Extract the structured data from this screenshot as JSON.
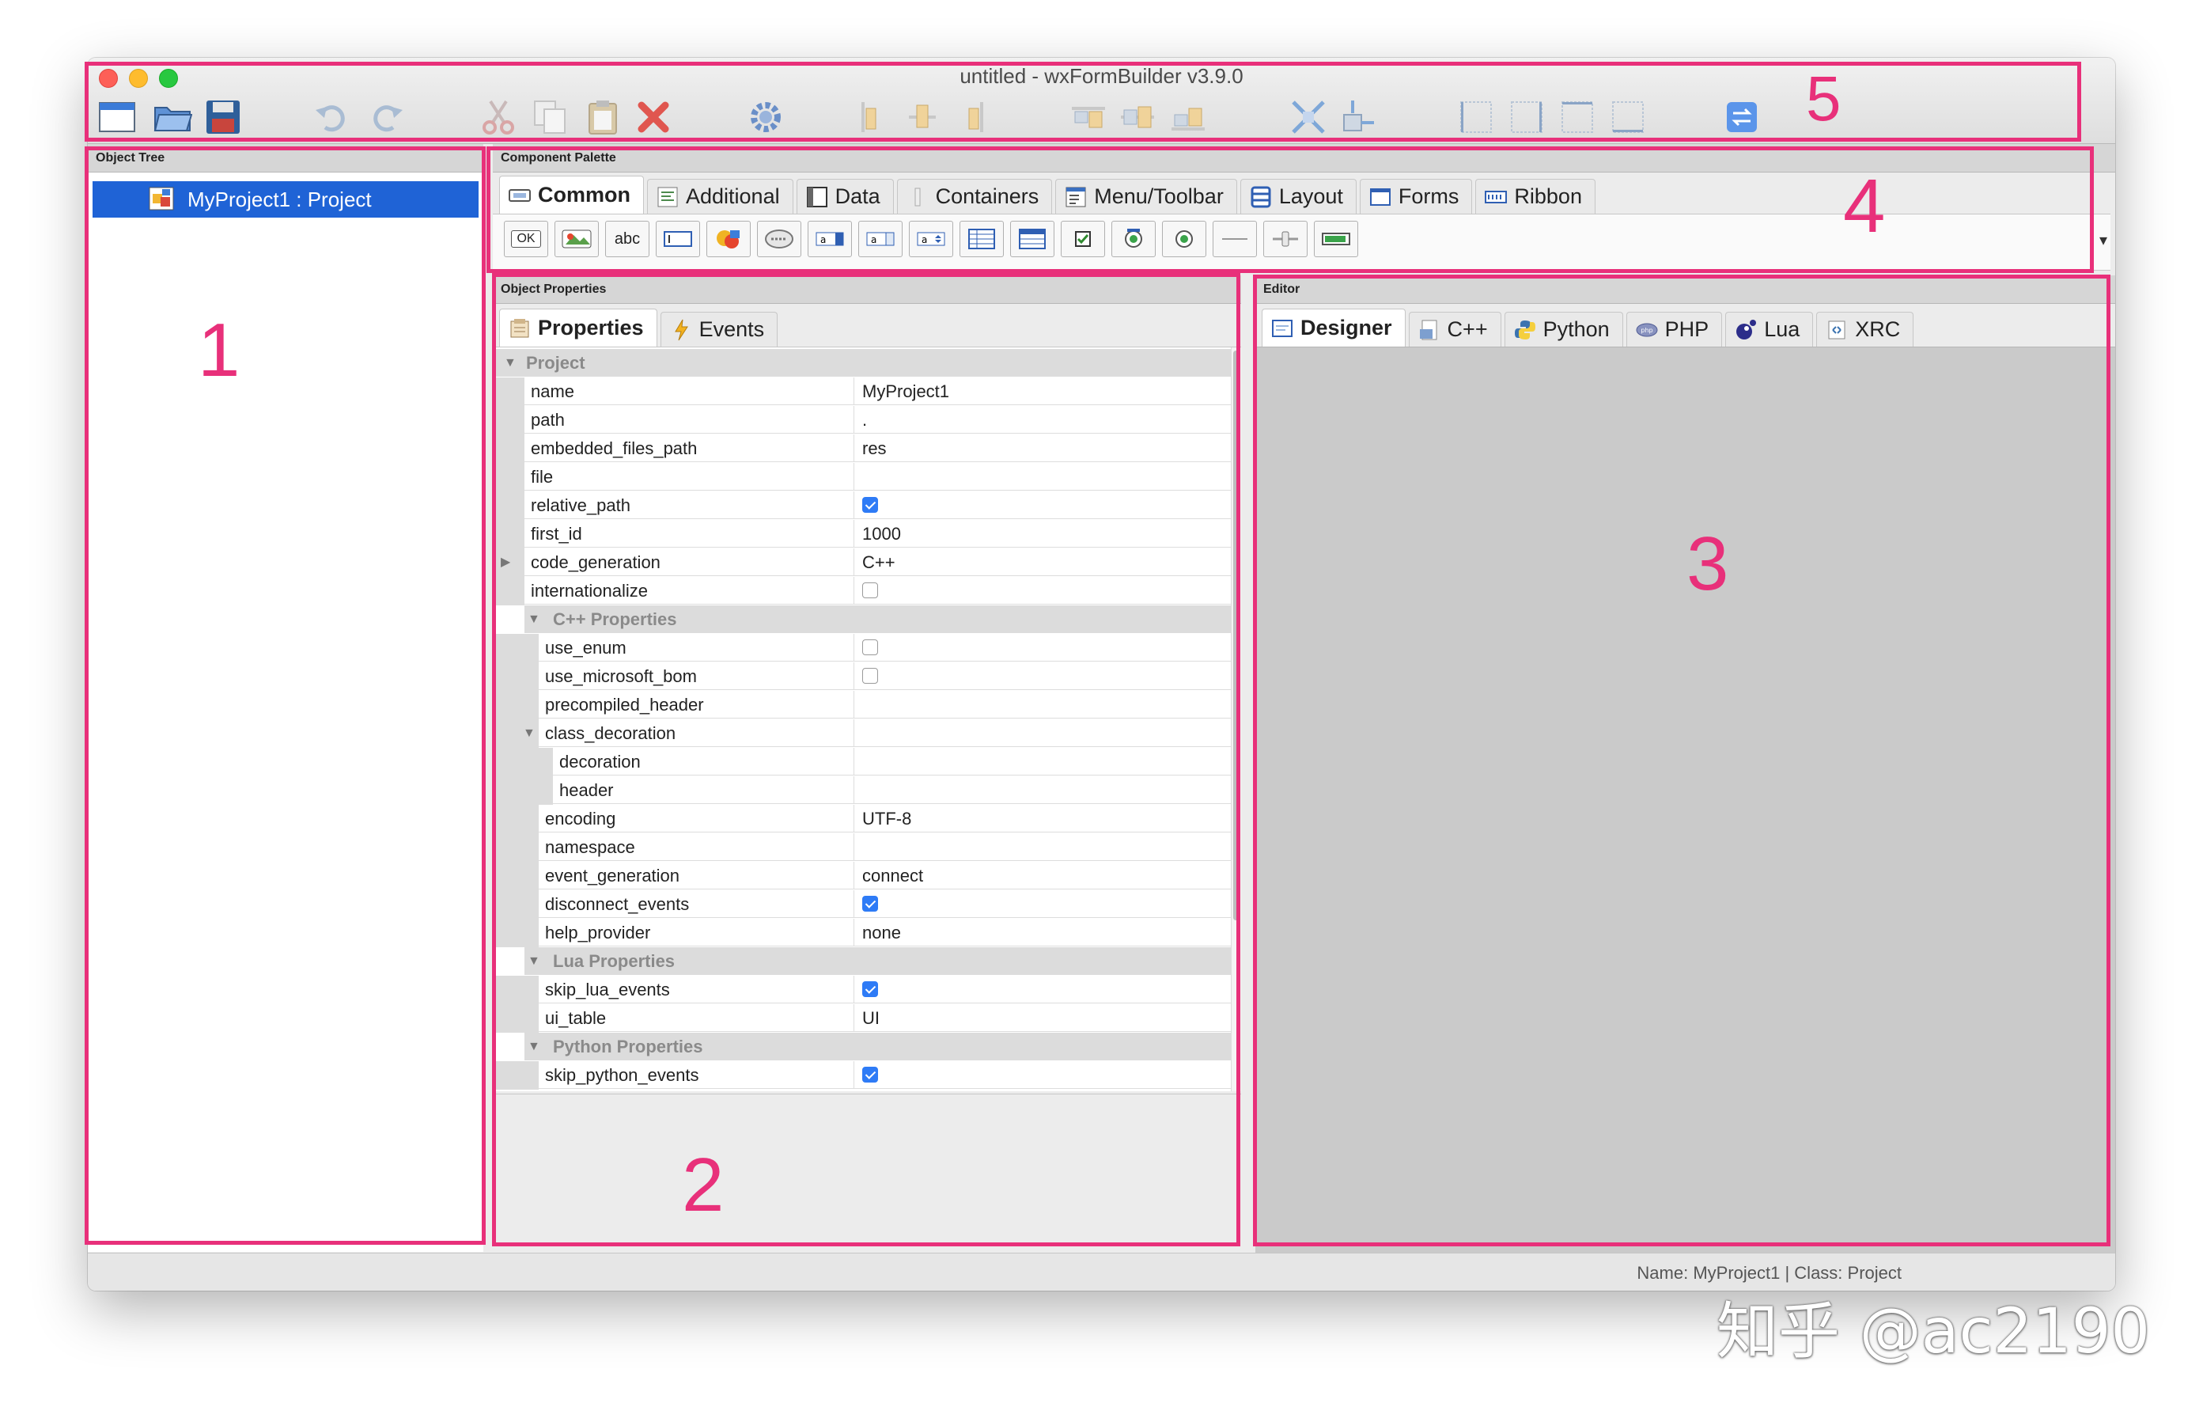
{
  "window": {
    "title": "untitled - wxFormBuilder v3.9.0",
    "traffic_colors": [
      "#fd5f57",
      "#febc2e",
      "#28c840"
    ]
  },
  "toolbar": {
    "tools": [
      {
        "icon": "new-project-icon"
      },
      {
        "icon": "open-folder-icon"
      },
      {
        "icon": "save-icon"
      },
      {
        "icon": "undo-icon"
      },
      {
        "icon": "redo-icon"
      },
      {
        "icon": "cut-icon"
      },
      {
        "icon": "copy-icon"
      },
      {
        "icon": "paste-icon"
      },
      {
        "icon": "delete-icon"
      },
      {
        "icon": "generate-code-icon"
      },
      {
        "icon": "align-left-icon"
      },
      {
        "icon": "align-center-icon"
      },
      {
        "icon": "align-right-icon"
      },
      {
        "icon": "align-top-icon"
      },
      {
        "icon": "align-middle-icon"
      },
      {
        "icon": "align-bottom-icon"
      },
      {
        "icon": "expand-icon"
      },
      {
        "icon": "stretch-icon"
      },
      {
        "icon": "border-left-icon"
      },
      {
        "icon": "border-right-icon"
      },
      {
        "icon": "border-top-icon"
      },
      {
        "icon": "border-bottom-icon"
      },
      {
        "icon": "swap-icon"
      }
    ]
  },
  "object_tree": {
    "caption": "Object Tree",
    "root_label": "MyProject1 : Project",
    "root_icon": "project-icon"
  },
  "palette": {
    "caption": "Component Palette",
    "tabs": [
      {
        "label": "Common",
        "icon": "common-tab-icon",
        "active": true
      },
      {
        "label": "Additional",
        "icon": "additional-tab-icon"
      },
      {
        "label": "Data",
        "icon": "data-tab-icon"
      },
      {
        "label": "Containers",
        "icon": "containers-tab-icon"
      },
      {
        "label": "Menu/Toolbar",
        "icon": "menu-toolbar-tab-icon"
      },
      {
        "label": "Layout",
        "icon": "layout-tab-icon"
      },
      {
        "label": "Forms",
        "icon": "forms-tab-icon"
      },
      {
        "label": "Ribbon",
        "icon": "ribbon-tab-icon"
      }
    ],
    "components": [
      {
        "icon": "button-icon",
        "text": "OK"
      },
      {
        "icon": "bitmap-button-icon"
      },
      {
        "icon": "static-text-icon",
        "text": "abc"
      },
      {
        "icon": "text-ctrl-icon"
      },
      {
        "icon": "static-bitmap-icon"
      },
      {
        "icon": "combo-box-icon"
      },
      {
        "icon": "choice-icon"
      },
      {
        "icon": "list-box-icon"
      },
      {
        "icon": "spin-ctrl-icon"
      },
      {
        "icon": "list-ctrl-icon"
      },
      {
        "icon": "grid-icon"
      },
      {
        "icon": "checkbox-icon"
      },
      {
        "icon": "radio-box-icon"
      },
      {
        "icon": "radio-button-icon"
      },
      {
        "icon": "static-line-icon"
      },
      {
        "icon": "slider-icon"
      },
      {
        "icon": "gauge-icon"
      }
    ],
    "overflow_icon": "overflow-arrow-icon"
  },
  "properties": {
    "caption": "Object Properties",
    "tabs": [
      {
        "label": "Properties",
        "icon": "properties-tab-icon",
        "active": true
      },
      {
        "label": "Events",
        "icon": "events-tab-icon"
      }
    ],
    "rows": [
      {
        "kind": "cat",
        "label": "Project",
        "level": 0
      },
      {
        "kind": "prop",
        "name": "name",
        "value": "MyProject1",
        "level": 0
      },
      {
        "kind": "prop",
        "name": "path",
        "value": ".",
        "level": 0
      },
      {
        "kind": "prop",
        "name": "embedded_files_path",
        "value": "res",
        "level": 0
      },
      {
        "kind": "prop",
        "name": "file",
        "value": "",
        "level": 0
      },
      {
        "kind": "prop",
        "name": "relative_path",
        "check": true,
        "level": 0
      },
      {
        "kind": "prop",
        "name": "first_id",
        "value": "1000",
        "level": 0
      },
      {
        "kind": "prop",
        "name": "code_generation",
        "value": "C++",
        "level": 0,
        "expander": "collapsed"
      },
      {
        "kind": "prop",
        "name": "internationalize",
        "check": false,
        "level": 0
      },
      {
        "kind": "cat",
        "label": "C++ Properties",
        "level": 1
      },
      {
        "kind": "prop",
        "name": "use_enum",
        "check": false,
        "level": 1
      },
      {
        "kind": "prop",
        "name": "use_microsoft_bom",
        "check": false,
        "level": 1
      },
      {
        "kind": "prop",
        "name": "precompiled_header",
        "value": "",
        "level": 1
      },
      {
        "kind": "prop",
        "name": "class_decoration",
        "value": "",
        "level": 1,
        "expander": "expanded"
      },
      {
        "kind": "prop",
        "name": "decoration",
        "value": "",
        "level": 2
      },
      {
        "kind": "prop",
        "name": "header",
        "value": "",
        "level": 2
      },
      {
        "kind": "prop",
        "name": "encoding",
        "value": "UTF-8",
        "level": 1
      },
      {
        "kind": "prop",
        "name": "namespace",
        "value": "",
        "level": 1
      },
      {
        "kind": "prop",
        "name": "event_generation",
        "value": "connect",
        "level": 1
      },
      {
        "kind": "prop",
        "name": "disconnect_events",
        "check": true,
        "level": 1
      },
      {
        "kind": "prop",
        "name": "help_provider",
        "value": "none",
        "level": 1
      },
      {
        "kind": "cat",
        "label": "Lua Properties",
        "level": 1
      },
      {
        "kind": "prop",
        "name": "skip_lua_events",
        "check": true,
        "level": 1
      },
      {
        "kind": "prop",
        "name": "ui_table",
        "value": "UI",
        "level": 1
      },
      {
        "kind": "cat",
        "label": "Python Properties",
        "level": 1
      },
      {
        "kind": "prop",
        "name": "skip_python_events",
        "check": true,
        "level": 1
      }
    ]
  },
  "editor": {
    "caption": "Editor",
    "tabs": [
      {
        "label": "Designer",
        "icon": "designer-tab-icon",
        "active": true
      },
      {
        "label": "C++",
        "icon": "cpp-tab-icon"
      },
      {
        "label": "Python",
        "icon": "python-tab-icon"
      },
      {
        "label": "PHP",
        "icon": "php-tab-icon"
      },
      {
        "label": "Lua",
        "icon": "lua-tab-icon"
      },
      {
        "label": "XRC",
        "icon": "xrc-tab-icon"
      }
    ]
  },
  "statusbar": {
    "text": "Name: MyProject1 | Class: Project"
  },
  "annotations": {
    "color": "#e8307a",
    "labels": [
      "1",
      "2",
      "3",
      "4",
      "5"
    ]
  },
  "watermark": "知乎 @ac2190"
}
